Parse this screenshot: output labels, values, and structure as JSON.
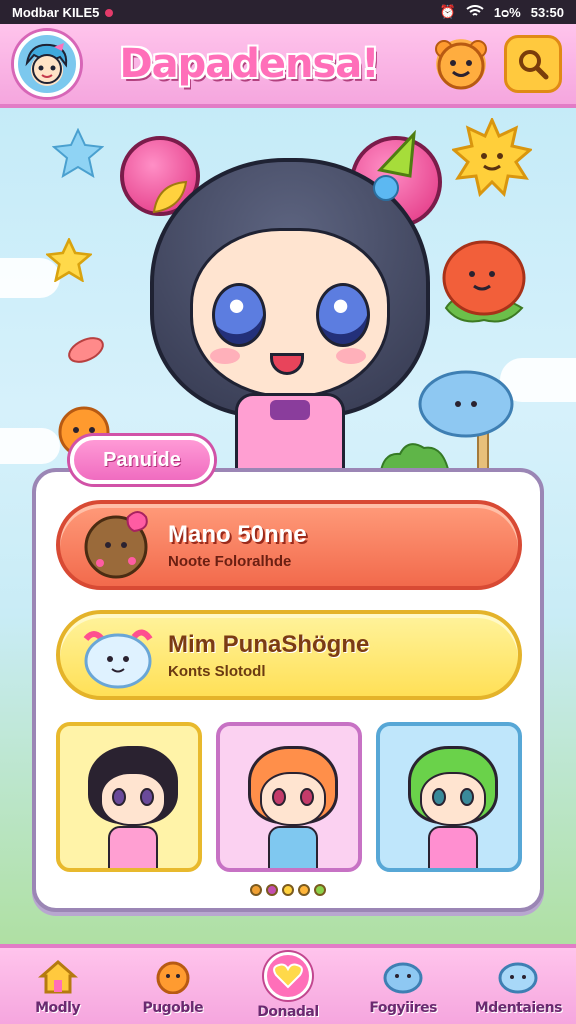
{
  "status_bar": {
    "left": "Modbar KILE5",
    "battery": "1ᴑ%",
    "time": "53:50"
  },
  "header": {
    "title": "Dapadensa!"
  },
  "panel": {
    "tab_label": "Panuide",
    "modes": [
      {
        "title": "Mano 50nne",
        "subtitle": "Noote Foloralhde"
      },
      {
        "title": "Mim PunaShögne",
        "subtitle": "Konts Slotodl"
      }
    ],
    "page_dots": [
      "#f0a033",
      "#c34fb0",
      "#ffd23e",
      "#ffb53a",
      "#8bd14a"
    ]
  },
  "nav": {
    "items": [
      {
        "label": "Modly"
      },
      {
        "label": "Pugoble"
      },
      {
        "label": "Donadal"
      },
      {
        "label": "Fogyiires"
      },
      {
        "label": "Mdentaiens"
      }
    ]
  },
  "colors": {
    "accent_pink": "#ff6fb9",
    "bar_pink": "#f5a6de",
    "orange_button": "#f26a4c",
    "yellow_button": "#ffe057"
  }
}
